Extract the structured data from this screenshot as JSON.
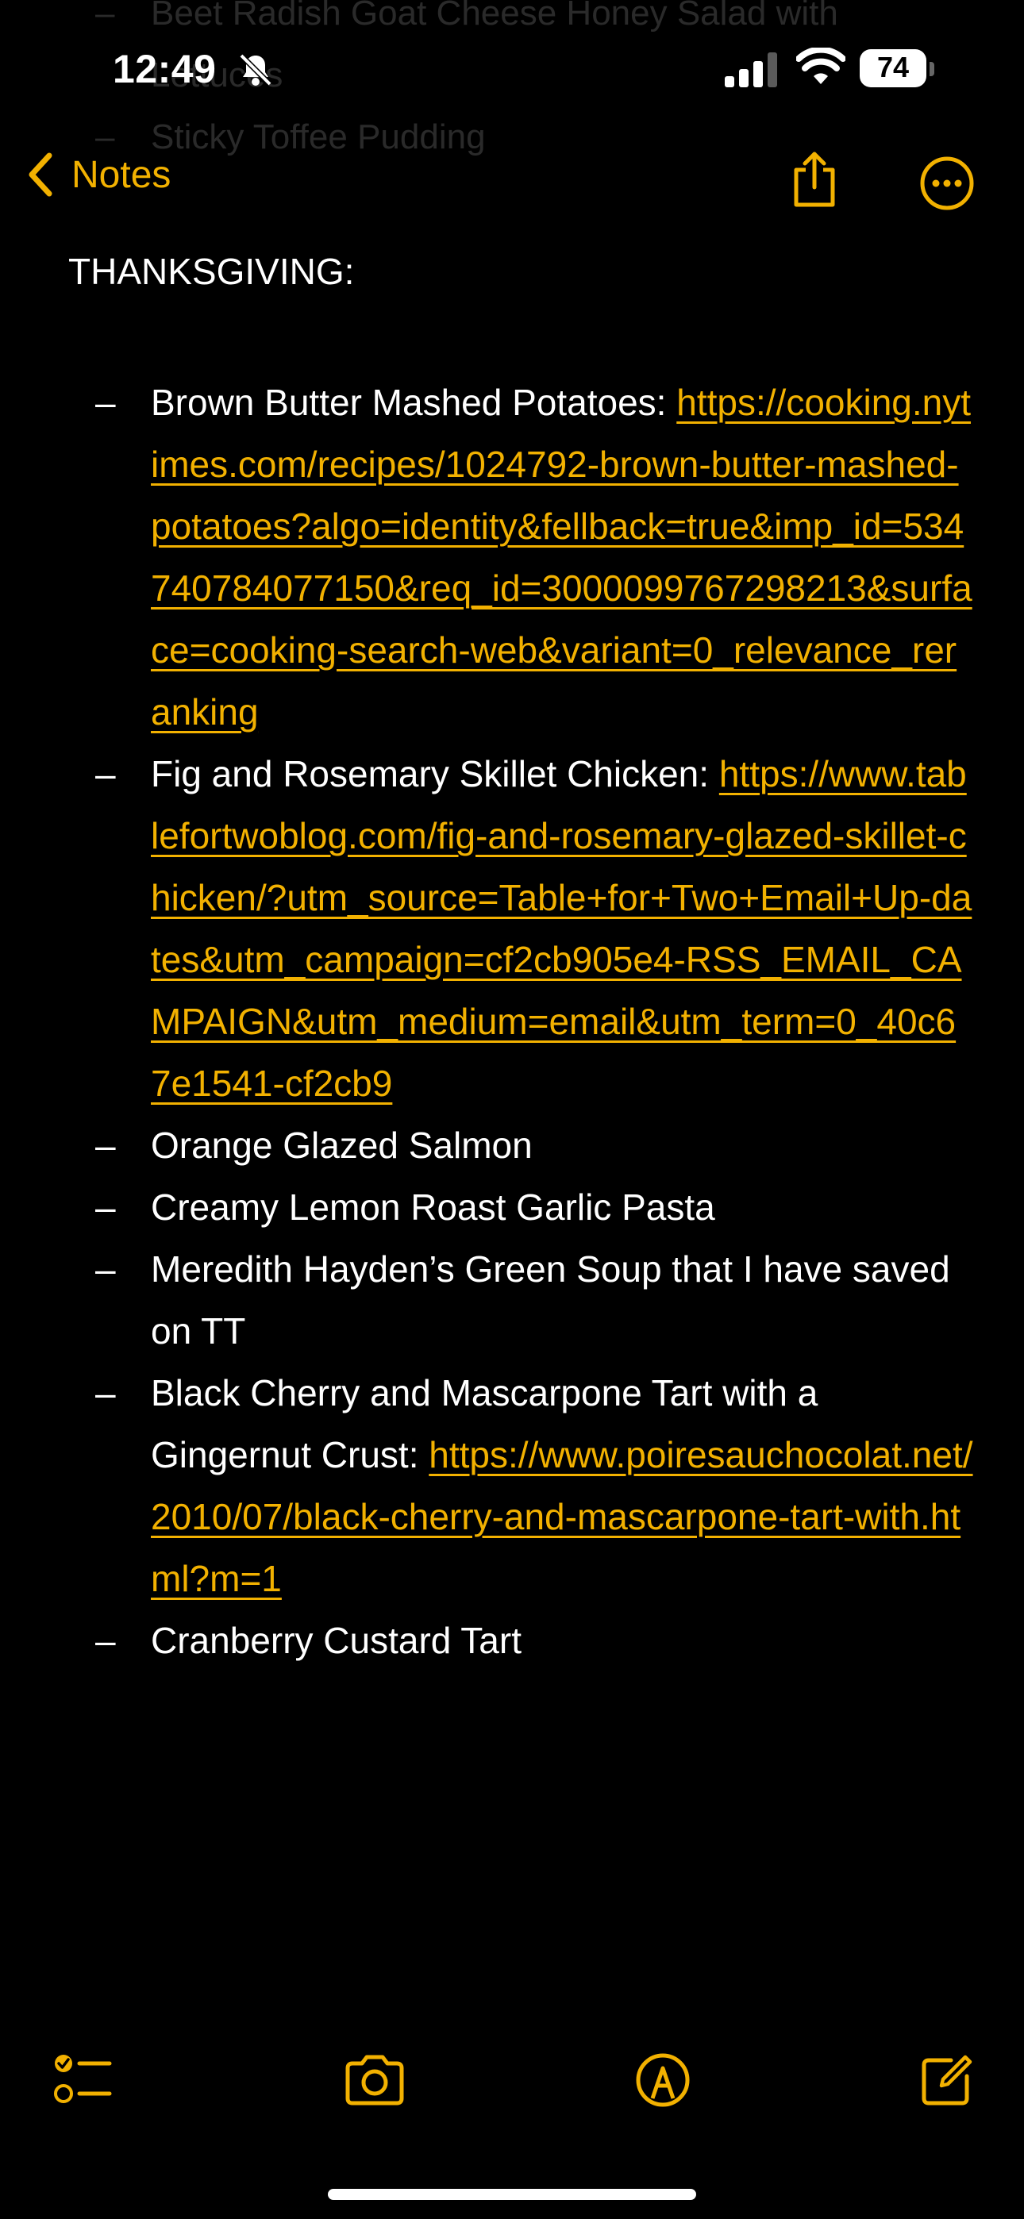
{
  "status_bar": {
    "time": "12:49",
    "battery": "74"
  },
  "scrolled_behind": [
    {
      "dash": "–",
      "text": "Beet Radish Goat Cheese Honey Salad with"
    },
    {
      "dash": "",
      "text": "Lettuces"
    },
    {
      "dash": "–",
      "text": "Sticky Toffee Pudding"
    }
  ],
  "nav": {
    "back_label": "Notes"
  },
  "note": {
    "title": "THANKSGIVING:",
    "items": [
      {
        "text": "Brown Butter Mashed Potatoes: ",
        "link": "https://cooking.nytimes.com/recipes/1024792-brown-butter-mashed-potatoes?algo=identity&fellback=true&imp_id=534740784077150&req_id=3000099767298213&surface=cooking-search-web&variant=0_relevance_reranking"
      },
      {
        "text": "Fig and Rosemary Skillet Chicken: ",
        "link": "https://www.tablefortwoblog.com/fig-and-rosemary-glazed-skillet-chicken/?utm_source=Table+for+Two+Email+Up-dates&utm_campaign=cf2cb905e4-RSS_EMAIL_CAMPAIGN&utm_medium=email&utm_term=0_40c67e1541-cf2cb9"
      },
      {
        "text": "Orange Glazed Salmon",
        "link": ""
      },
      {
        "text": "Creamy Lemon Roast Garlic Pasta",
        "link": ""
      },
      {
        "text": "Meredith Hayden’s Green Soup that I have saved on TT",
        "link": ""
      },
      {
        "text": "Black Cherry and Mascarpone Tart with a Gingernut Crust: ",
        "link": "https://www.poiresauchocolat.net/2010/07/black-cherry-and-mascarpone-tart-with.html?m=1"
      },
      {
        "text": "Cranberry Custard Tart",
        "link": ""
      }
    ],
    "bullet": "–"
  },
  "toolbar": [
    "checklist-icon",
    "camera-icon",
    "markup-icon",
    "compose-icon"
  ],
  "colors": {
    "accent": "#f2b100",
    "background": "#000000",
    "text": "#ffffff"
  }
}
